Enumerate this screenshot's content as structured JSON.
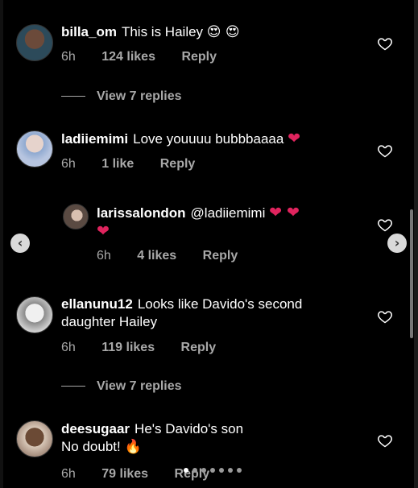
{
  "comments": [
    {
      "username": "billa_om",
      "text": "This is Hailey",
      "emoji": "😍 😍",
      "time": "6h",
      "likes": "124 likes",
      "reply": "Reply",
      "avatar_color": "#4a6a7a"
    },
    {
      "username": "ladiiemimi",
      "text": "Love youuuu bubbbaaaa",
      "emoji": "❤",
      "time": "6h",
      "likes": "1 like",
      "reply": "Reply",
      "avatar_color": "#c9b8c5"
    },
    {
      "username": "larissalondon",
      "text": "@ladiiemimi",
      "emoji": "❤ ❤",
      "emoji2": "❤",
      "time": "6h",
      "likes": "4 likes",
      "reply": "Reply",
      "avatar_color": "#8a7a72"
    },
    {
      "username": "ellanunu12",
      "text": "Looks like Davido's second",
      "text2": "daughter Hailey",
      "time": "6h",
      "likes": "119 likes",
      "reply": "Reply",
      "avatar_color": "#d8d8d8"
    },
    {
      "username": "deesugaar",
      "text": "He's Davido's son",
      "text2": "No doubt!",
      "emoji": "🔥",
      "time": "6h",
      "likes": "79 likes",
      "reply": "Reply",
      "avatar_color": "#5a4030"
    }
  ],
  "view_replies": [
    "View 7 replies",
    "View 7 replies"
  ],
  "nav": {
    "prev": "‹",
    "next": "›"
  },
  "colors": {
    "heart": "#e0245e",
    "meta": "#a8a8a8",
    "background": "#000000"
  }
}
